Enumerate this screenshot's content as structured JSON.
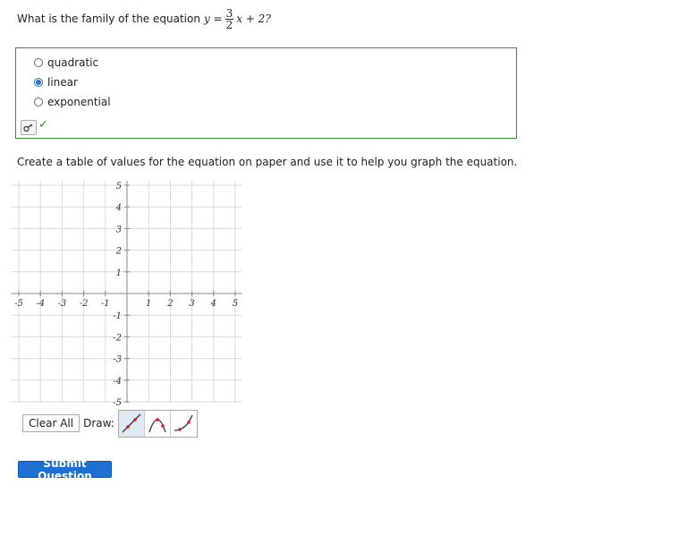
{
  "question": {
    "prefix": "What is the family of the equation",
    "eq_lhs": "y =",
    "eq_num": "3",
    "eq_den": "2",
    "eq_tail": "x + 2?"
  },
  "options": [
    {
      "label": "quadratic",
      "selected": false
    },
    {
      "label": "linear",
      "selected": true
    },
    {
      "label": "exponential",
      "selected": false
    }
  ],
  "check_mark": "✓",
  "instruction": "Create a table of values for the equation on paper and use it to help you graph the equation.",
  "graph": {
    "x_ticks": [
      "-5",
      "-4",
      "-3",
      "-2",
      "-1",
      "1",
      "2",
      "3",
      "4",
      "5"
    ],
    "y_ticks": [
      "5",
      "4",
      "3",
      "2",
      "1",
      "-1",
      "-2",
      "-3",
      "-4",
      "-5"
    ]
  },
  "toolbar": {
    "clear_label": "Clear All",
    "draw_label": "Draw:",
    "tools": [
      "line-tool-icon",
      "parabola-tool-icon",
      "exponential-tool-icon"
    ]
  },
  "submit_label": "Submit Question",
  "colors": {
    "correct_border": "#2e9a2e",
    "accent": "#1d6fd1",
    "tool_red": "#d42020"
  }
}
